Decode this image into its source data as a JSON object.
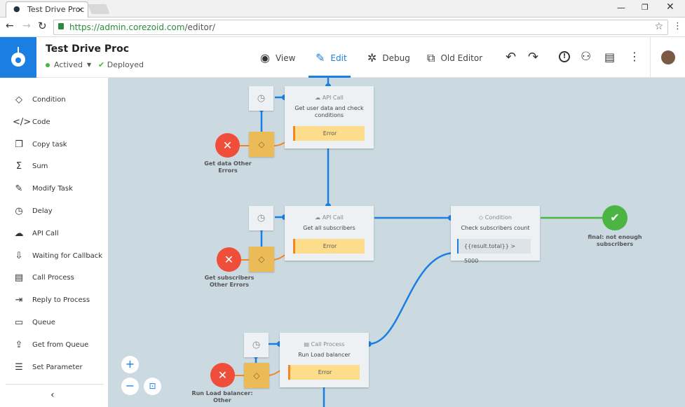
{
  "browser": {
    "tab_title": "Test Drive Proc",
    "url_host": "https://admin.corezoid.com",
    "url_path": "/editor/"
  },
  "header": {
    "title": "Test Drive Proc",
    "status": "Actived",
    "deploy_status": "Deployed",
    "nav": [
      {
        "label": "View",
        "icon": "eye-icon"
      },
      {
        "label": "Edit",
        "icon": "pencil-icon"
      },
      {
        "label": "Debug",
        "icon": "bug-icon"
      },
      {
        "label": "Old Editor",
        "icon": "old-editor-icon"
      }
    ],
    "active_tab": "Edit"
  },
  "sidebar": {
    "items": [
      {
        "label": "Condition",
        "icon": "◇"
      },
      {
        "label": "Code",
        "icon": "</>"
      },
      {
        "label": "Copy task",
        "icon": "❐"
      },
      {
        "label": "Sum",
        "icon": "Σ"
      },
      {
        "label": "Modify Task",
        "icon": "✎"
      },
      {
        "label": "Delay",
        "icon": "◷"
      },
      {
        "label": "API Call",
        "icon": "☁"
      },
      {
        "label": "Waiting for Callback",
        "icon": "⇩"
      },
      {
        "label": "Call Process",
        "icon": "▤"
      },
      {
        "label": "Reply to Process",
        "icon": "⇥"
      },
      {
        "label": "Queue",
        "icon": "▭"
      },
      {
        "label": "Get from Queue",
        "icon": "⇪"
      },
      {
        "label": "Set Parameter",
        "icon": "☰"
      }
    ],
    "collapse": "‹"
  },
  "nodes": {
    "n1": {
      "type": "API Call",
      "title": "Get user data and check conditions",
      "error": "Error",
      "error_label": "Get data Other Errors"
    },
    "n2": {
      "type": "API Call",
      "title": "Get all subscribers",
      "error": "Error",
      "error_label": "Get subscribers Other Errors"
    },
    "cond": {
      "type": "Condition",
      "title": "Check subscribers count",
      "expr": "{{result.total}} > 5000"
    },
    "final": {
      "label": "final: not enough subscribers"
    },
    "n3": {
      "type": "Call Process",
      "title": "Run Load balancer",
      "error": "Error",
      "error_label": "Run Load balancer: Other"
    }
  },
  "colors": {
    "brand": "#1a7fe0",
    "error": "#ef4f3a",
    "success": "#4bb543",
    "link": "#1a7fe0",
    "canvas": "#cbd9e1"
  }
}
